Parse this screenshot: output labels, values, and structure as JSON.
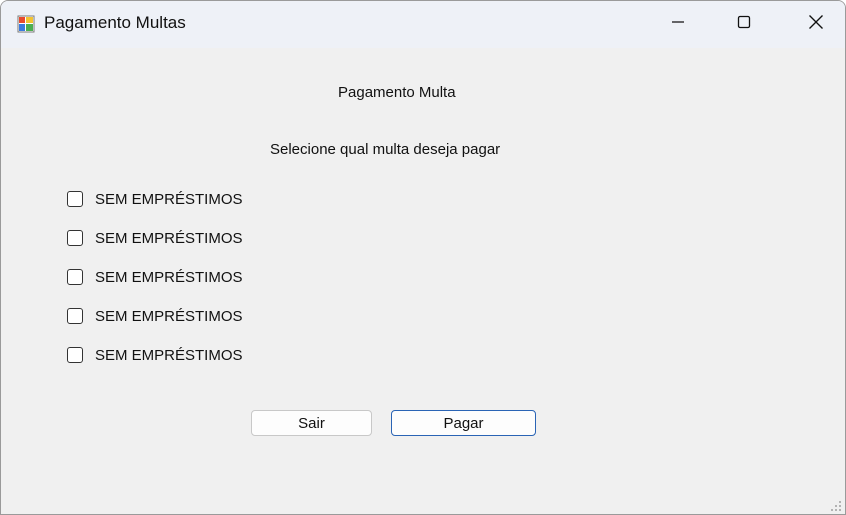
{
  "window": {
    "title": "Pagamento Multas"
  },
  "titlebar_buttons": {
    "minimize_icon": "minimize-icon",
    "maximize_icon": "maximize-icon",
    "close_icon": "close-icon"
  },
  "form": {
    "heading": "Pagamento Multa",
    "subheading": "Selecione qual multa deseja pagar",
    "options": [
      {
        "label": "SEM EMPRÉSTIMOS",
        "checked": false
      },
      {
        "label": "SEM EMPRÉSTIMOS",
        "checked": false
      },
      {
        "label": "SEM EMPRÉSTIMOS",
        "checked": false
      },
      {
        "label": "SEM EMPRÉSTIMOS",
        "checked": false
      },
      {
        "label": "SEM EMPRÉSTIMOS",
        "checked": false
      }
    ],
    "buttons": {
      "exit_label": "Sair",
      "pay_label": "Pagar"
    }
  },
  "colors": {
    "titlebar_bg": "#eef1f7",
    "client_bg": "#f0f0f0",
    "default_button_border": "#2a64b5"
  }
}
